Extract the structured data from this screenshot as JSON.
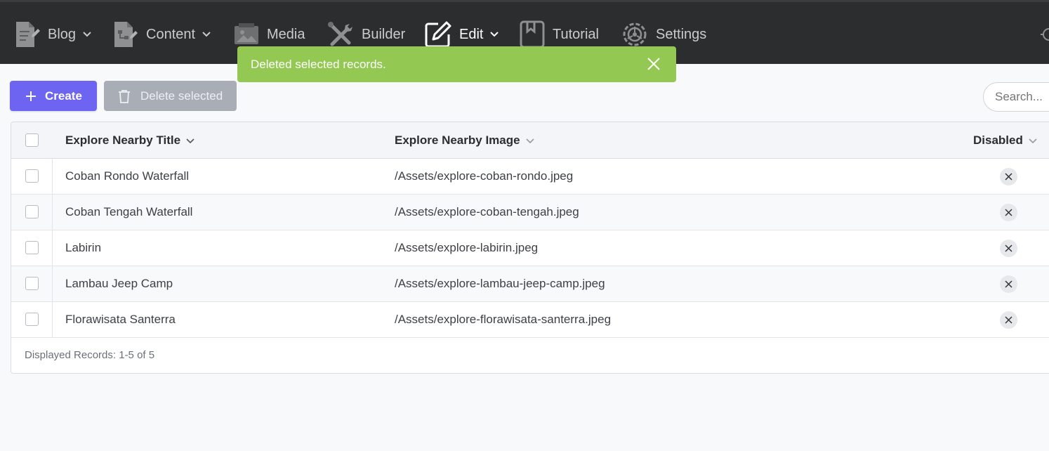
{
  "nav": {
    "items": [
      {
        "label": "Blog",
        "icon": "blog-icon",
        "dropdown": true
      },
      {
        "label": "Content",
        "icon": "content-icon",
        "dropdown": true
      },
      {
        "label": "Media",
        "icon": "media-icon",
        "dropdown": false
      },
      {
        "label": "Builder",
        "icon": "builder-icon",
        "dropdown": false
      },
      {
        "label": "Edit",
        "icon": "edit-icon",
        "dropdown": true,
        "active": true
      },
      {
        "label": "Tutorial",
        "icon": "tutorial-icon",
        "dropdown": false
      },
      {
        "label": "Settings",
        "icon": "settings-icon",
        "dropdown": false
      }
    ]
  },
  "toast": {
    "message": "Deleted selected records.",
    "color": "#93c852"
  },
  "toolbar": {
    "create_label": "Create",
    "delete_label": "Delete selected",
    "search_placeholder": "Search..."
  },
  "table": {
    "columns": [
      {
        "label": "Explore Nearby Title"
      },
      {
        "label": "Explore Nearby Image"
      },
      {
        "label": "Disabled"
      }
    ],
    "rows": [
      {
        "title": "Coban Rondo Waterfall",
        "image": "/Assets/explore-coban-rondo.jpeg",
        "disabled": false
      },
      {
        "title": "Coban Tengah Waterfall",
        "image": "/Assets/explore-coban-tengah.jpeg",
        "disabled": false
      },
      {
        "title": "Labirin",
        "image": "/Assets/explore-labirin.jpeg",
        "disabled": false
      },
      {
        "title": "Lambau Jeep Camp",
        "image": "/Assets/explore-lambau-jeep-camp.jpeg",
        "disabled": false
      },
      {
        "title": "Florawisata Santerra",
        "image": "/Assets/explore-florawisata-santerra.jpeg",
        "disabled": false
      }
    ],
    "footer": "Displayed Records: 1-5 of 5"
  },
  "colors": {
    "topbar": "#2b2d2f",
    "primary": "#6d65f2",
    "success": "#93c852"
  }
}
